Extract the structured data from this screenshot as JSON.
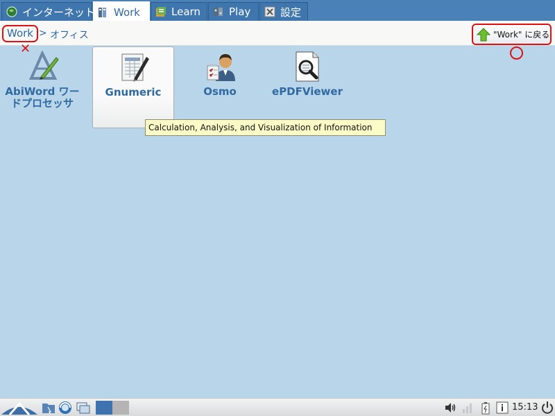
{
  "tabs": [
    {
      "label": "インターネット",
      "icon": "globe-icon"
    },
    {
      "label": "Work",
      "icon": "work-icon",
      "active": true
    },
    {
      "label": "Learn",
      "icon": "learn-icon"
    },
    {
      "label": "Play",
      "icon": "play-icon"
    },
    {
      "label": "設定",
      "icon": "settings-icon"
    }
  ],
  "breadcrumb": {
    "root": "Work",
    "separator": ">",
    "current": "オフィス"
  },
  "back_button": {
    "label": "\"Work\" に戻る",
    "icon": "up-arrow-icon"
  },
  "annotations": {
    "x_mark": "✕"
  },
  "apps": [
    {
      "label": "AbiWord ワードプロセッサ",
      "icon": "abiword-icon"
    },
    {
      "label": "Gnumeric",
      "icon": "gnumeric-icon",
      "selected": true
    },
    {
      "label": "Osmo",
      "icon": "osmo-icon"
    },
    {
      "label": "ePDFViewer",
      "icon": "epdfviewer-icon"
    }
  ],
  "tooltip": "Calculation, Analysis, and Visualization of Information",
  "panel": {
    "clock": "15:13"
  },
  "colors": {
    "tabbar": "#4a82b8",
    "desktop": "#b9d5ea",
    "accent_text": "#2f6aa3",
    "annotation_red": "#e01010"
  }
}
